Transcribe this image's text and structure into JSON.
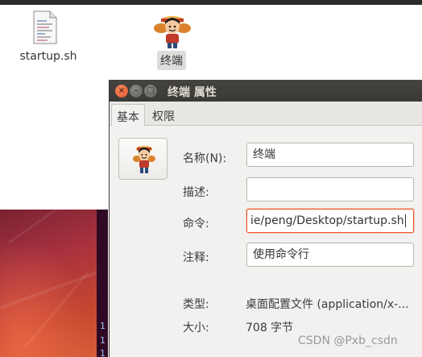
{
  "desktop": {
    "file_icon_label": "startup.sh",
    "app_icon_label": "终端",
    "terminal_lines": [
      "1",
      "1",
      "1"
    ]
  },
  "dialog": {
    "title": "终端 属性",
    "close_glyph": "×",
    "minimize_glyph": "–",
    "maximize_glyph": "□",
    "tabs": [
      "基本",
      "权限"
    ],
    "fields": {
      "name_label": "名称(N):",
      "name_value": "终端",
      "desc_label": "描述:",
      "desc_value": "",
      "cmd_label": "命令:",
      "cmd_value": "ie/peng/Desktop/startup.sh",
      "comment_label": "注释:",
      "comment_value": "使用命令行"
    },
    "info": {
      "type_label": "类型:",
      "type_value": "桌面配置文件 (application/x-...",
      "size_label": "大小:",
      "size_value": "708 字节"
    }
  },
  "watermark": "CSDN @Pxb_csdn",
  "colors": {
    "titlebar": "#3c3b37",
    "focus_border": "#e95420",
    "wallpaper": "#a8323e"
  }
}
